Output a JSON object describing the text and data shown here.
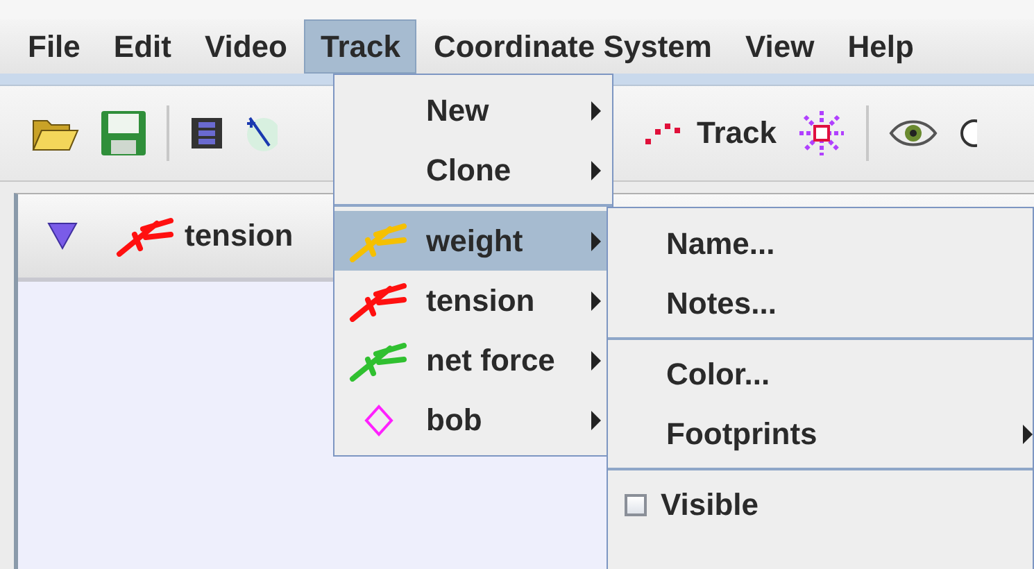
{
  "menubar": [
    {
      "label": "File",
      "selected": false
    },
    {
      "label": "Edit",
      "selected": false
    },
    {
      "label": "Video",
      "selected": false
    },
    {
      "label": "Track",
      "selected": true
    },
    {
      "label": "Coordinate System",
      "selected": false
    },
    {
      "label": "View",
      "selected": false
    },
    {
      "label": "Help",
      "selected": false
    }
  ],
  "toolbar": {
    "track_button": "Track"
  },
  "track_bar": {
    "track": "tension"
  },
  "track_menu": [
    {
      "kind": "submenu",
      "label": "New"
    },
    {
      "kind": "submenu",
      "label": "Clone"
    },
    {
      "kind": "separator"
    },
    {
      "kind": "vector",
      "label": "weight",
      "color": "#f5c000",
      "selected": true
    },
    {
      "kind": "vector",
      "label": "tension",
      "color": "#ff1010",
      "selected": false
    },
    {
      "kind": "vector",
      "label": "net force",
      "color": "#30c030",
      "selected": false
    },
    {
      "kind": "point",
      "label": "bob",
      "color": "#ff20ff",
      "selected": false
    }
  ],
  "track_submenu": [
    {
      "kind": "command",
      "label": "Name..."
    },
    {
      "kind": "command",
      "label": "Notes..."
    },
    {
      "kind": "separator"
    },
    {
      "kind": "command",
      "label": "Color..."
    },
    {
      "kind": "submenu",
      "label": "Footprints"
    },
    {
      "kind": "separator"
    },
    {
      "kind": "checkbox",
      "label": "Visible",
      "checked": false
    }
  ]
}
